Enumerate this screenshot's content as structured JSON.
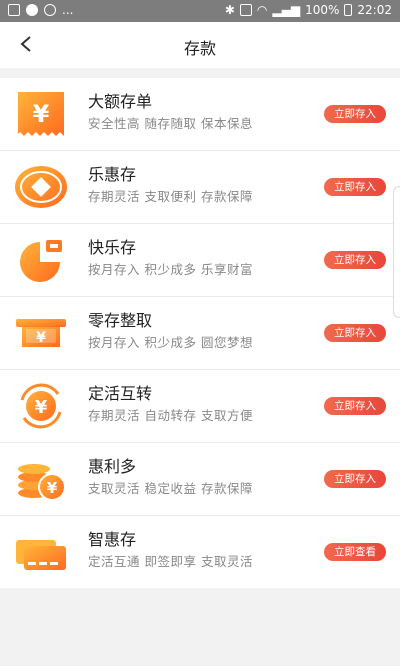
{
  "status": {
    "time": "22:02",
    "battery": "100%",
    "ellipsis": "..."
  },
  "header": {
    "title": "存款"
  },
  "items": [
    {
      "name": "大额存单",
      "desc": "安全性高 随存随取 保本保息",
      "button": "立即存入",
      "icon": "ticket-yuan-icon"
    },
    {
      "name": "乐惠存",
      "desc": "存期灵活 支取便利 存款保障",
      "button": "立即存入",
      "icon": "diamond-coin-icon"
    },
    {
      "name": "快乐存",
      "desc": "按月存入 积少成多 乐享财富",
      "button": "立即存入",
      "icon": "piggy-bank-icon"
    },
    {
      "name": "零存整取",
      "desc": "按月存入 积少成多 圆您梦想",
      "button": "立即存入",
      "icon": "atm-slot-icon"
    },
    {
      "name": "定活互转",
      "desc": "存期灵活 自动转存 支取方便",
      "button": "立即存入",
      "icon": "exchange-coin-icon"
    },
    {
      "name": "惠利多",
      "desc": "支取灵活 稳定收益 存款保障",
      "button": "立即存入",
      "icon": "coin-stack-icon"
    },
    {
      "name": "智惠存",
      "desc": "定活互通 即签即享 支取灵活",
      "button": "立即查看",
      "icon": "cards-icon"
    }
  ],
  "colors": {
    "accent_start": "#ffb43a",
    "accent_end": "#ff6a1e",
    "button": "#e9463a"
  }
}
